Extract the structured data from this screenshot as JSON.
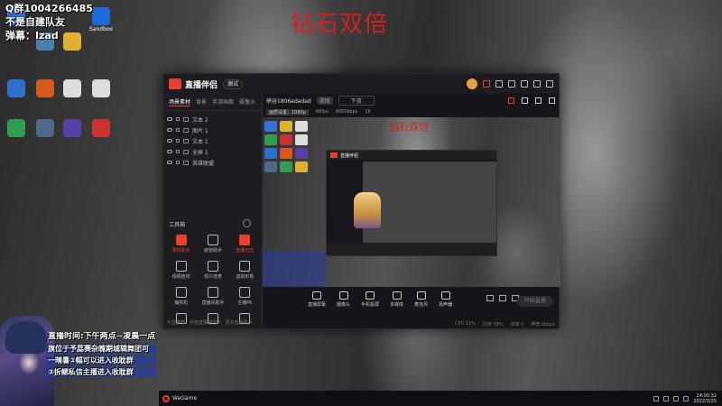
{
  "wallpaper_title": "钻石双倍",
  "overlay": {
    "qq_group": "Q群1004266485",
    "line2": "不是自建队友",
    "line3": "弹幕：Izad"
  },
  "desktop_icons": [
    {
      "label": "",
      "icon": "blank-doc-icon",
      "color": "#3a6fd8"
    },
    {
      "label": "",
      "icon": "file-icon",
      "color": "#4a7fb0"
    },
    {
      "label": "",
      "icon": "game-icon",
      "color": "#e0b030"
    },
    {
      "label": "Sandbox",
      "icon": "sandbox-icon",
      "color": "#1e6ad8"
    },
    {
      "label": "",
      "icon": "folder-icon",
      "color": "#2c72c9"
    },
    {
      "label": "",
      "icon": "game-icon",
      "color": "#d65a1e"
    },
    {
      "label": "",
      "icon": "doc-icon",
      "color": "#dddddd"
    },
    {
      "label": "",
      "icon": "doc-icon",
      "color": "#dddddd"
    },
    {
      "label": "",
      "icon": "app-icon",
      "color": "#2f9c52"
    },
    {
      "label": "",
      "icon": "app-icon",
      "color": "#4d6a8a"
    },
    {
      "label": "",
      "icon": "app-icon",
      "color": "#5a3fa8"
    },
    {
      "label": "",
      "icon": "app-icon",
      "color": "#c93131"
    }
  ],
  "app": {
    "name": "直播伴侣",
    "version": "测试",
    "room": "峡谷1806adadad",
    "room_tag": "游戏",
    "room_dropdown": "下游",
    "stats": {
      "quality": "画质设置：1080p",
      "fps": "60fps",
      "bitrate": "6000kbps",
      "count": "16"
    },
    "tabs": [
      "场景素材",
      "背景",
      "手游画面",
      "摄像头"
    ],
    "sources": [
      {
        "name": "文本 2"
      },
      {
        "name": "图片 1"
      },
      {
        "name": "文本 1"
      },
      {
        "name": "全屏 1"
      },
      {
        "name": "英雄联盟"
      }
    ],
    "toolbox_title": "工具箱",
    "tools": [
      {
        "label": "录屏助手",
        "highlight": true
      },
      {
        "label": "房管助手",
        "highlight": false
      },
      {
        "label": "直播日志",
        "highlight": true
      },
      {
        "label": "视频连线",
        "highlight": false
      },
      {
        "label": "观众连麦",
        "highlight": false
      },
      {
        "label": "虚拟形象",
        "highlight": false
      },
      {
        "label": "抽奖机",
        "highlight": false
      },
      {
        "label": "直播间助手",
        "highlight": false
      },
      {
        "label": "主播PK",
        "highlight": false
      },
      {
        "label": "",
        "highlight": false
      },
      {
        "label": "",
        "highlight": false
      },
      {
        "label": "",
        "highlight": false
      }
    ],
    "left_footer": "为您推荐：抖音直播伴侣IP，更多直播助手",
    "preview_title": "钻石双倍",
    "live_buttons": [
      "直播屏幕",
      "摄像头",
      "手机投屏",
      "多媒体",
      "麦克风",
      "扬声器"
    ],
    "start_button": "开始直播",
    "status": [
      "CPU 11%",
      "内存 39%",
      "帧率 0",
      "带宽 0kbps"
    ]
  },
  "chat": {
    "line1": "直播时间:下午两点~凌晨一点",
    "line2": "旗位于予蕊赛杂魄期城辑舞团可",
    "line3": "一晴暑②幅可以进入收耽群",
    "line4": "③拆鳃私信主播进入收耽群"
  },
  "taskbar": {
    "app": "WeGame",
    "time": "14:00:32",
    "date": "2022/3/25"
  }
}
